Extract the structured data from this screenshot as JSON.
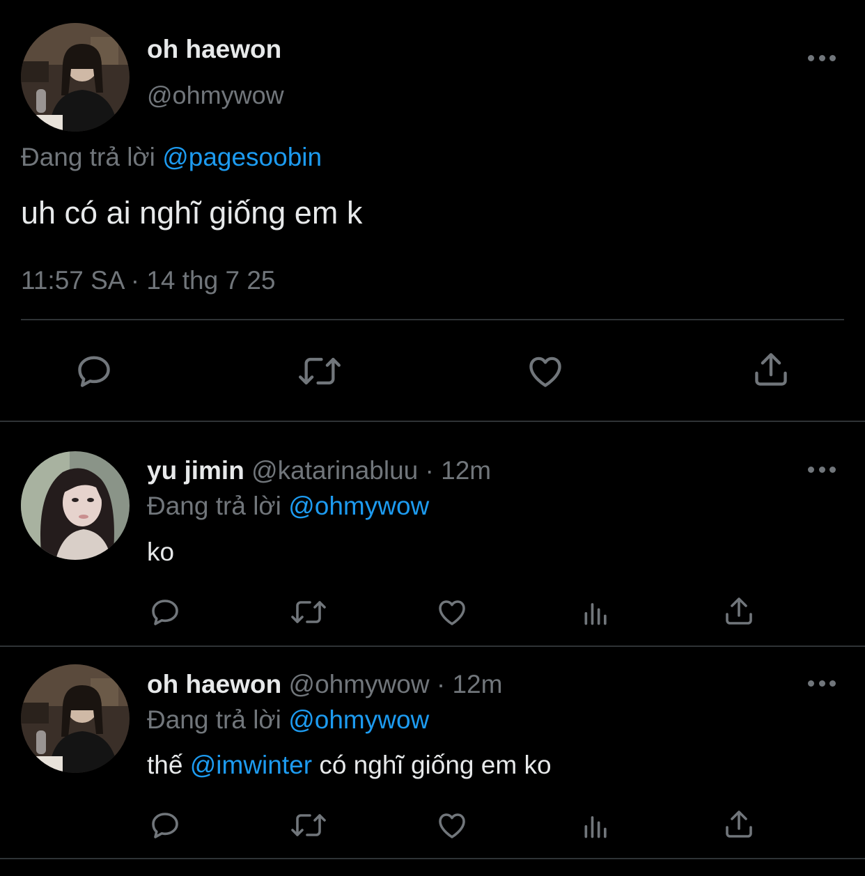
{
  "main_tweet": {
    "display_name": "oh haewon",
    "handle": "@ohmywow",
    "reply_prefix": "Đang trả lời",
    "reply_to": "@pagesoobin",
    "text": "uh có ai nghĩ giống em k",
    "timestamp": "11:57 SA · 14 thg 7 25"
  },
  "replies": [
    {
      "display_name": "yu jimin",
      "handle": "@katarinabluu",
      "separator": "·",
      "time": "12m",
      "reply_prefix": "Đang trả lời",
      "reply_to": "@ohmywow",
      "text": "ko"
    },
    {
      "display_name": "oh haewon",
      "handle": "@ohmywow",
      "separator": "·",
      "time": "12m",
      "reply_prefix": "Đang trả lời",
      "reply_to": "@ohmywow",
      "text_before": "thế",
      "mention": "@imwinter",
      "text_after": "có nghĩ giống em ko"
    }
  ],
  "icons": {
    "reply": "reply-icon",
    "retweet": "retweet-icon",
    "like": "heart-icon",
    "views": "views-icon",
    "share": "share-icon",
    "more": "more-icon"
  },
  "colors": {
    "background": "#000000",
    "text": "#e7e9ea",
    "muted": "#71767b",
    "link": "#1d9bf0",
    "divider": "#2f3336"
  }
}
